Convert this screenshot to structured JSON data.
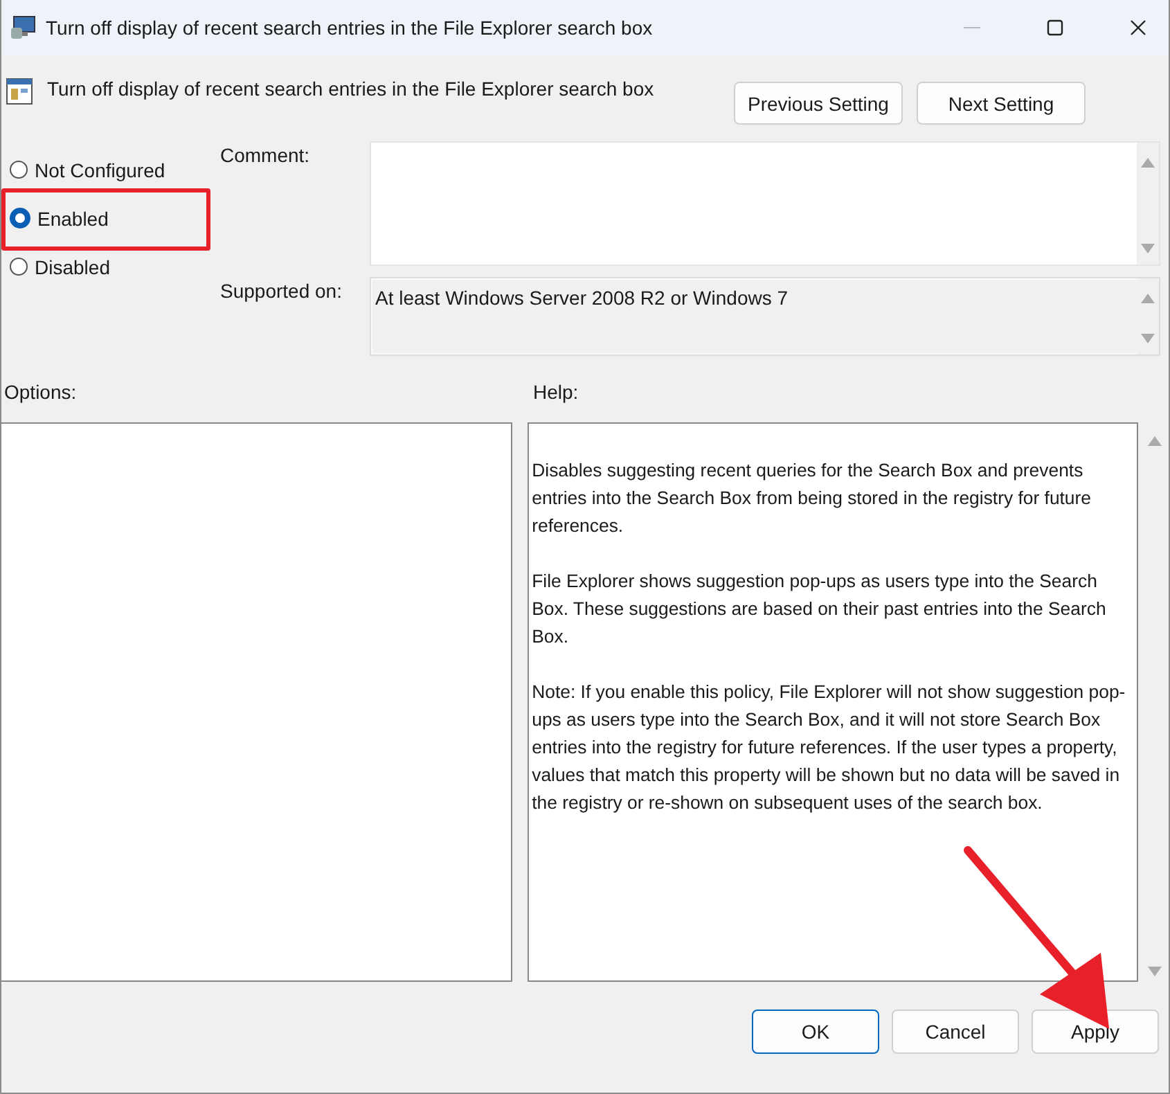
{
  "window": {
    "title": "Turn off display of recent search entries in the File Explorer search box"
  },
  "policy": {
    "title": "Turn off display of recent search entries in the File Explorer search box"
  },
  "nav_buttons": [
    "Previous Setting",
    "Next Setting"
  ],
  "states": [
    {
      "label": "Not Configured",
      "selected": false
    },
    {
      "label": "Enabled",
      "selected": true
    },
    {
      "label": "Disabled",
      "selected": false
    }
  ],
  "comment": {
    "label": "Comment:"
  },
  "supported": {
    "label": "Supported on:",
    "value": "At least Windows Server 2008 R2 or Windows 7"
  },
  "options": {
    "label": "Options:"
  },
  "help": {
    "label": "Help:",
    "paragraphs": [
      "Disables suggesting recent queries for the Search Box and prevents entries into the Search Box from being stored in the registry for future references.",
      "File Explorer shows suggestion pop-ups as users type into the Search Box.  These suggestions are based on their past entries into the Search Box.",
      "Note: If you enable this policy, File Explorer will not show suggestion pop-ups as users type into the Search Box, and it will not store Search Box entries into the registry for future references.  If the user types a property, values that match this property will be shown but no data will be saved in the registry or re-shown on subsequent uses of the search box."
    ]
  },
  "buttons": [
    {
      "label": "OK",
      "kind": "default"
    },
    {
      "label": "Cancel",
      "kind": "normal"
    },
    {
      "label": "Apply",
      "kind": "normal"
    }
  ]
}
